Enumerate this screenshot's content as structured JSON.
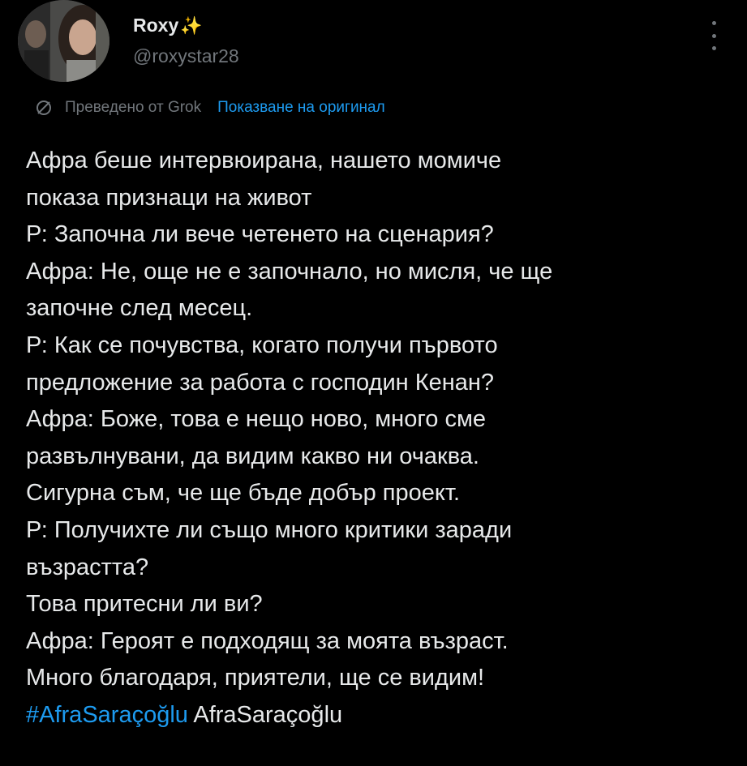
{
  "author": {
    "display_name": "Roxy",
    "badge_emoji": "✨",
    "handle": "@roxystar28",
    "avatar_icon": "profile-photo"
  },
  "translation": {
    "icon": "translate-icon",
    "translated_by": "Преведено от Grok",
    "show_original": "Показване на оригинал"
  },
  "tweet": {
    "lines": [
      " Афра беше интервюирана, нашето момиче",
      "показа признаци на живот",
      "Р: Започна ли вече четенето на сценария?",
      "Афра: Не, още не е започнало, но мисля, че ще",
      "започне след месец.",
      "Р: Как се почувства, когато получи първото",
      "предложение за работа с господин Кенан?",
      "Афра: Боже, това е нещо ново, много сме",
      "развълнувани, да видим какво ни очаква.",
      "Сигурна съм, че ще бъде добър проект.",
      "Р: Получихте ли също много критики заради",
      "възрастта?",
      "Това притесни ли ви?",
      "Афра: Героят е подходящ за моята възраст.",
      "Много благодаря, приятели, ще се видим!"
    ],
    "hashtag": "#AfraSaraçoğlu",
    "trailing_text": " AfraSaraçoğlu"
  },
  "colors": {
    "background": "#000000",
    "text": "#e7e9ea",
    "secondary": "#71767b",
    "link": "#1d9bf0"
  }
}
